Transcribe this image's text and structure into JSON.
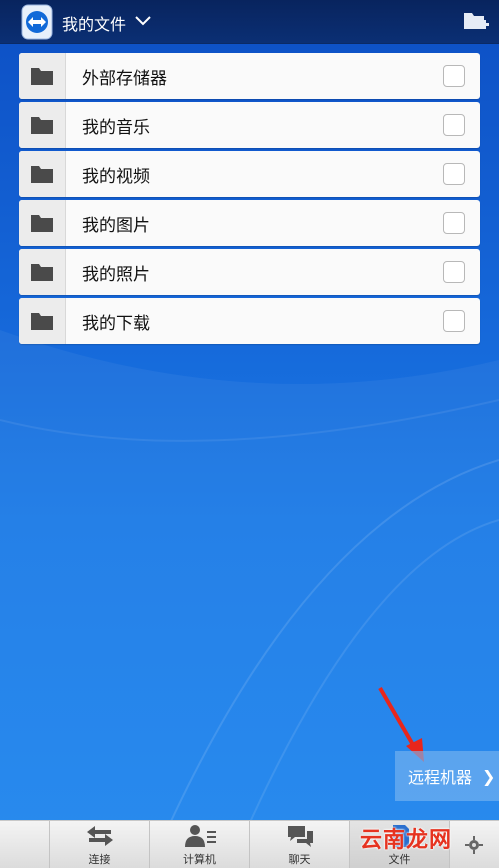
{
  "header": {
    "title": "我的文件"
  },
  "folders": [
    {
      "label": "外部存储器"
    },
    {
      "label": "我的音乐"
    },
    {
      "label": "我的视频"
    },
    {
      "label": "我的图片"
    },
    {
      "label": "我的照片"
    },
    {
      "label": "我的下载"
    }
  ],
  "remote_button": {
    "label": "远程机器",
    "chevron": "❯"
  },
  "tabs": [
    {
      "label": "连接",
      "icon": "arrows-icon"
    },
    {
      "label": "计算机",
      "icon": "contacts-icon"
    },
    {
      "label": "聊天",
      "icon": "chat-icon"
    },
    {
      "label": "文件",
      "icon": "file-icon",
      "active": true
    }
  ],
  "watermark": "云南龙网",
  "colors": {
    "header_bg": "#0b2f74",
    "background": "#1566d8",
    "arrow": "#e8261c"
  }
}
